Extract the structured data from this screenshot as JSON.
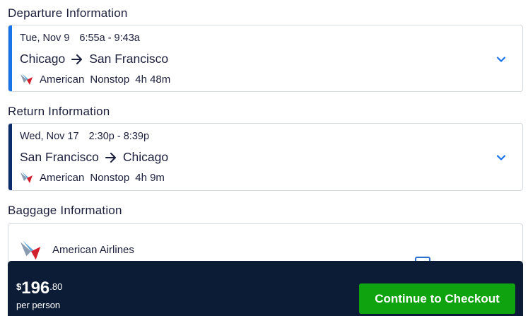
{
  "departure": {
    "heading": "Departure Information",
    "date": "Tue, Nov 9",
    "time": "6:55a - 9:43a",
    "origin": "Chicago",
    "destination": "San Francisco",
    "airline": "American",
    "stops": "Nonstop",
    "duration": "4h 48m",
    "accent_color": "#1a73e8"
  },
  "return": {
    "heading": "Return Information",
    "date": "Wed, Nov 17",
    "time": "2:30p - 8:39p",
    "origin": "San Francisco",
    "destination": "Chicago",
    "airline": "American",
    "stops": "Nonstop",
    "duration": "4h 9m",
    "accent_color": "#0d2a6b"
  },
  "baggage": {
    "heading": "Baggage Information",
    "airline_name": "American Airlines"
  },
  "checkout": {
    "currency": "$",
    "price_dollars": "196",
    "price_cents": ".80",
    "per_person": "per person",
    "button_label": "Continue to Checkout",
    "button_color": "#0fa40f",
    "bar_color": "#0c1c36"
  },
  "icons": {
    "expand": "chevron-down-icon",
    "direction": "arrow-right-icon",
    "airline_logo": "american-airlines-logo-icon"
  }
}
